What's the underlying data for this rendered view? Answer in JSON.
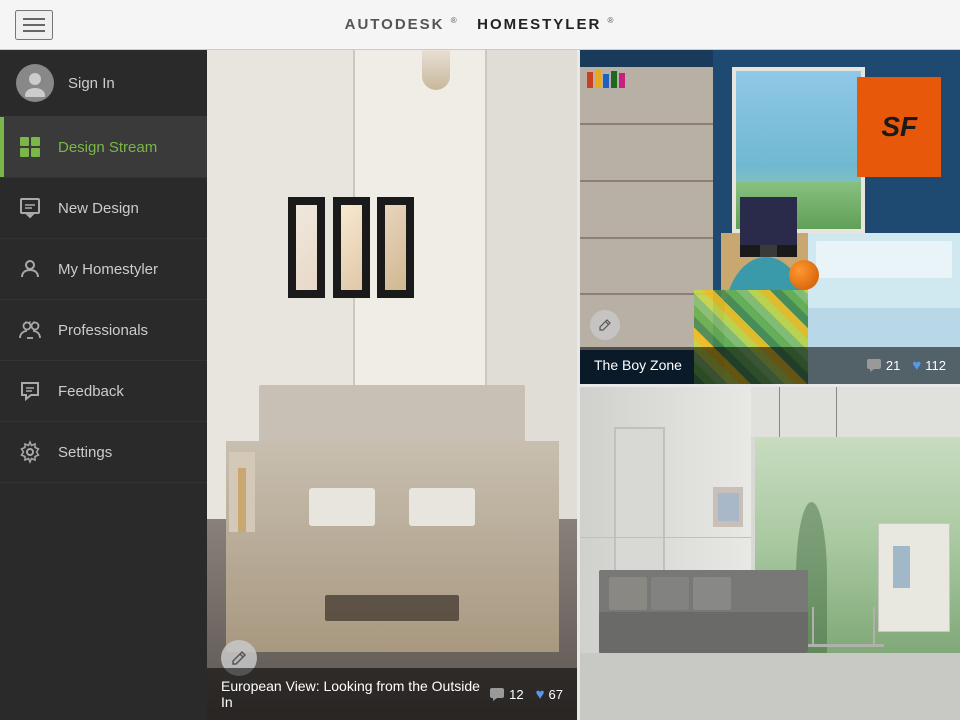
{
  "header": {
    "title_prefix": "AUTODESK",
    "title_tm": "®",
    "title_bold": "HOMESTYLER",
    "title_reg": "®"
  },
  "sidebar": {
    "signin_label": "Sign In",
    "items": [
      {
        "id": "design-stream",
        "label": "Design Stream",
        "active": true
      },
      {
        "id": "new-design",
        "label": "New Design",
        "active": false
      },
      {
        "id": "my-homestyler",
        "label": "My Homestyler",
        "active": false
      },
      {
        "id": "professionals",
        "label": "Professionals",
        "active": false
      },
      {
        "id": "feedback",
        "label": "Feedback",
        "active": false
      },
      {
        "id": "settings",
        "label": "Settings",
        "active": false
      }
    ]
  },
  "cards": {
    "left": {
      "title": "European View: Looking from the Outside In",
      "comments": "12",
      "likes": "67"
    },
    "top_right": {
      "title": "The Boy Zone",
      "comments": "21",
      "likes": "112",
      "logo": "SF"
    },
    "bottom_right": {
      "title": ""
    }
  },
  "icons": {
    "hamburger": "☰",
    "pencil": "✏",
    "chat_bubble": "💬",
    "heart": "♥"
  }
}
